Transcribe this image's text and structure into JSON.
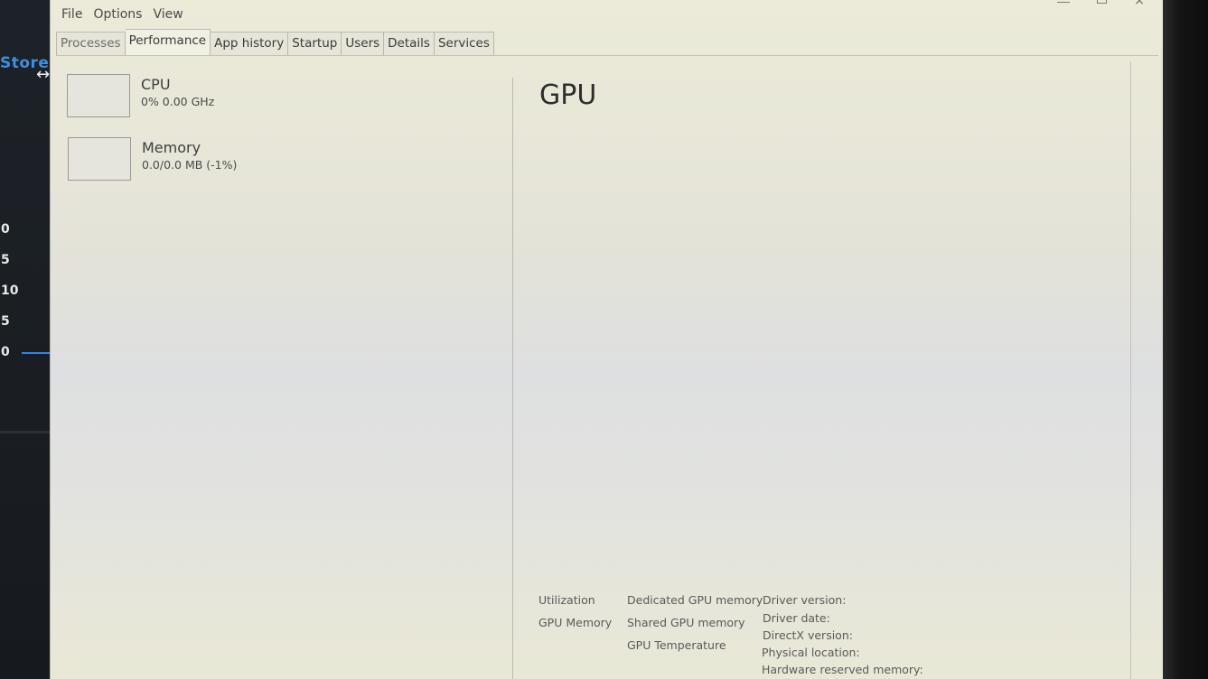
{
  "background": {
    "store_label": "Store",
    "resize_cursor": "↔",
    "ticks": [
      "0",
      "5",
      "10",
      "5",
      "0"
    ],
    "line_color": "#2e86e8"
  },
  "menu": {
    "items": [
      "File",
      "Options",
      "View"
    ]
  },
  "tabs": [
    "Processes",
    "Performance",
    "App history",
    "Startup",
    "Users",
    "Details",
    "Services"
  ],
  "active_tab": "Performance",
  "sidebar": {
    "cpu": {
      "title": "CPU",
      "detail": "0% 0.00 GHz"
    },
    "memory": {
      "title": "Memory",
      "detail": "0.0/0.0 MB (-1%)"
    }
  },
  "main": {
    "title": "GPU",
    "stats": {
      "col1": [
        "Utilization",
        "GPU Memory"
      ],
      "col2": [
        "Dedicated GPU memory",
        "Shared GPU memory",
        "GPU Temperature"
      ],
      "col3": [
        "Driver version:",
        "Driver date:",
        "DirectX version:",
        "Physical location:",
        "Hardware reserved memory:"
      ]
    }
  }
}
